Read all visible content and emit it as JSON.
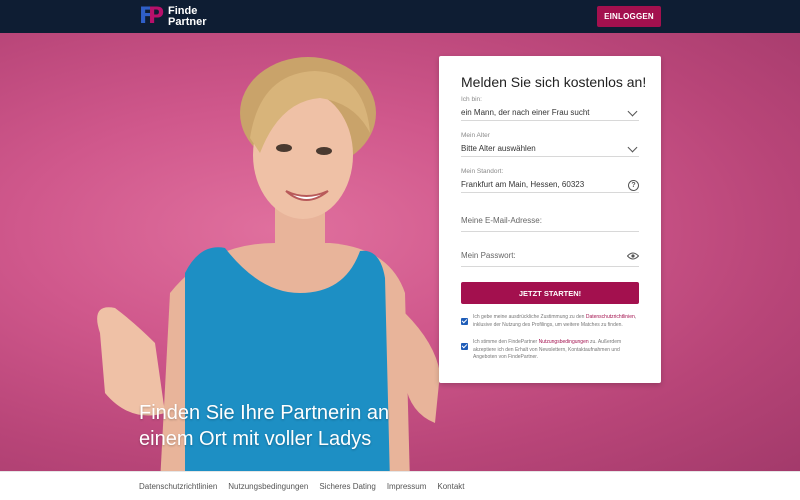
{
  "header": {
    "logo_line1": "Finde",
    "logo_line2": "Partner",
    "logo_mark": "FP",
    "login_label": "EINLOGGEN"
  },
  "hero": {
    "title": "Finden Sie Ihre Partnerin an einem Ort mit voller Ladys"
  },
  "form": {
    "title": "Melden Sie sich kostenlos an!",
    "seeking_label": "Ich bin:",
    "seeking_value": "ein Mann, der nach einer Frau sucht",
    "age_label": "Mein Alter",
    "age_value": "Bitte Alter auswählen",
    "location_label": "Mein Standort:",
    "location_value": "Frankfurt am Main, Hessen, 60323",
    "email_placeholder": "Meine E-Mail-Adresse:",
    "password_placeholder": "Mein Passwort:",
    "submit_label": "JETZT STARTEN!",
    "consent1_pre": "Ich gebe meine ausdrückliche Zustimmung zu den",
    "consent1_link": "Datenschutzrichtlinien",
    "consent1_post": ", inklusive der Nutzung des Profilings, um weitere Matches zu finden.",
    "consent2_pre": "Ich stimme den FindePartner",
    "consent2_link": "Nutzungsbedingungen",
    "consent2_post": " zu. Außerdem akzeptiere ich den Erhalt von Newslettern, Kontaktaufnahmen und Angeboten von FindePartner.",
    "icons": {
      "select_arrow": "chevron-down-icon",
      "help": "help-circle-icon",
      "password_toggle": "eye-icon"
    },
    "accent_color": "#a3104e"
  },
  "footer": {
    "links": [
      "Datenschutzrichtlinien",
      "Nutzungsbedingungen",
      "Sicheres Dating",
      "Impressum",
      "Kontakt"
    ]
  }
}
